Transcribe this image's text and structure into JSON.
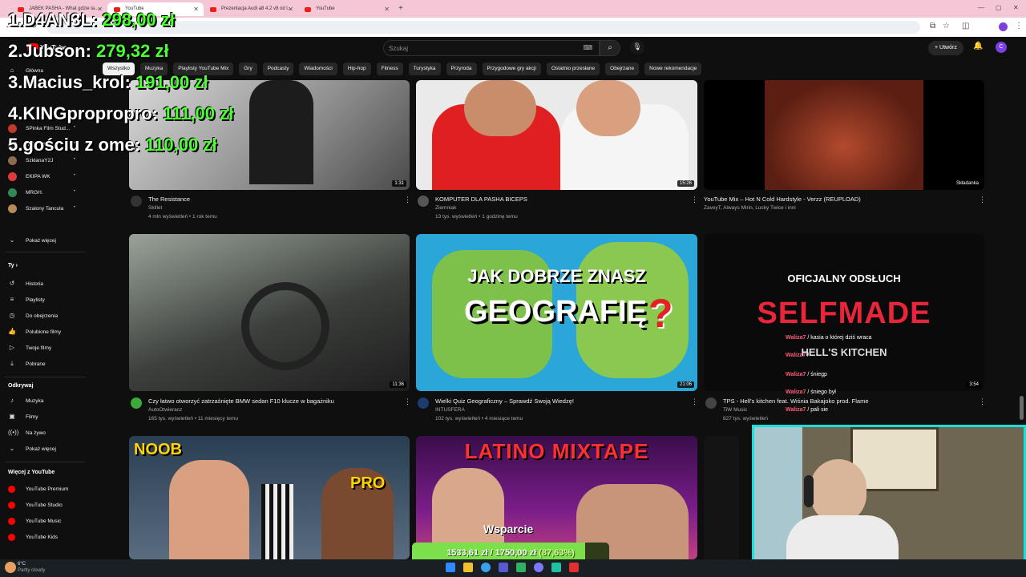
{
  "browser": {
    "tabs": [
      {
        "title": "JABEK PASHA - What gdzie ta..."
      },
      {
        "title": "YouTube"
      },
      {
        "title": "Prezentacja Audi a8 4.2 v8 od l..."
      },
      {
        "title": "YouTube"
      }
    ]
  },
  "header": {
    "logo": "YouTube",
    "search_placeholder": "Szukaj",
    "create_label": "Utwórz",
    "avatar_letter": "C"
  },
  "chips": [
    "Wszystko",
    "Muzyka",
    "Playlisty YouTube Mix",
    "Gry",
    "Podcasty",
    "Wiadomości",
    "Hip-hop",
    "Fitness",
    "Turystyka",
    "Przyroda",
    "Przygodowe gry akcji",
    "Ostatnio przesłane",
    "Obejrzane",
    "Nowe rekomendacje"
  ],
  "sidebar": {
    "main": [
      {
        "label": "Główna"
      }
    ],
    "subscriptions": [
      {
        "label": "SPinka Film Stud...",
        "color": "#c0392b"
      },
      {
        "label": "SENTINO",
        "color": "#555555"
      },
      {
        "label": "SzklanaY2J",
        "color": "#8e6b4f"
      },
      {
        "label": "EKIPA WK",
        "color": "#e03a3a"
      },
      {
        "label": "MRGH.",
        "color": "#2e8b57"
      },
      {
        "label": "Szalony Tancula",
        "color": "#b88a5a"
      }
    ],
    "show_more": "Pokaż więcej",
    "you_header": "Ty",
    "you": [
      {
        "label": "Historia",
        "icon": "history-icon"
      },
      {
        "label": "Playlisty",
        "icon": "playlist-icon"
      },
      {
        "label": "Do obejrzenia",
        "icon": "clock-icon"
      },
      {
        "label": "Polubione filmy",
        "icon": "like-icon"
      },
      {
        "label": "Twoje filmy",
        "icon": "play-icon"
      },
      {
        "label": "Pobrane",
        "icon": "download-icon"
      }
    ],
    "explore_header": "Odkrywaj",
    "explore": [
      {
        "label": "Muzyka",
        "icon": "music-icon"
      },
      {
        "label": "Filmy",
        "icon": "film-icon"
      },
      {
        "label": "Na żywo",
        "icon": "live-icon"
      }
    ],
    "show_more_2": "Pokaż więcej",
    "more_header": "Więcej z YouTube",
    "more": [
      {
        "label": "YouTube Premium"
      },
      {
        "label": "YouTube Studio"
      },
      {
        "label": "YouTube Music"
      },
      {
        "label": "YouTube Kids"
      }
    ]
  },
  "videos": [
    {
      "title": "The Resistance",
      "channel": "Skillet",
      "meta": "4 mln wyświetleń • 1 rok temu",
      "duration": "1:31"
    },
    {
      "title": "KOMPUTER DLA PASHA BICEPS",
      "channel": "Ziemniak",
      "meta": "13 tys. wyświetleń • 1 godzinę temu",
      "duration": "15:26"
    },
    {
      "title": "YouTube Mix – Hot N Cold Hardstyle - Verzz (REUPLOAD)",
      "channel": "ZaveyT, Always Mirin, Lucky Twice i inni",
      "meta": "",
      "duration": "Składanka"
    },
    {
      "title": "Czy łatwo otworzyć zatrzaśnięte BMW sedan F10 klucze w bagażniku",
      "channel": "AutoOtwieracz",
      "meta": "165 tys. wyświetleń • 11 miesięcy temu",
      "duration": "11:36"
    },
    {
      "title": "Wielki Quiz Geograficzny – Sprawdź Swoją Wiedzę!",
      "channel": "INTUSFERA",
      "meta": "102 tys. wyświetleń • 4 miesiące temu",
      "duration": "21:06"
    },
    {
      "title": "TPS - Hell's kitchen feat. Wiśnia Bakajoko prod. Flame",
      "channel": "TiW Music",
      "meta": "827 tys. wyświetleń",
      "duration": "3:54"
    }
  ],
  "thumb_text": {
    "geo_line1": "JAK DOBRZE ZNASZ",
    "geo_line2": "GEOGRAFIĘ",
    "geo_q": "?",
    "tps_line1": "OFICJALNY ODSŁUCH",
    "tps_line2": "SELFMADE",
    "tps_line3": "HELL'S KITCHEN",
    "noob": "NOOB",
    "pro": "PRO",
    "latino": "LATINO MIXTAPE",
    "wsparcie": "Wsparcie"
  },
  "leaderboard": [
    {
      "rank": "1.",
      "name": "D4AN3L:",
      "amount": "298,00 zł"
    },
    {
      "rank": "2.",
      "name": "Jubson:",
      "amount": "279,32 zł"
    },
    {
      "rank": "3.",
      "name": "Macius_krol:",
      "amount": "191,00 zł"
    },
    {
      "rank": "4.",
      "name": "KINGpropropro:",
      "amount": "111,00 zł"
    },
    {
      "rank": "5.",
      "name": "gościu z ome:",
      "amount": "110,00 zł"
    }
  ],
  "chat": [
    {
      "user": "Walizа7",
      "text": "kasia o której dziś wraca"
    },
    {
      "user": "Walizа7",
      "text": ""
    },
    {
      "user": "Walizа7",
      "text": "śniegp"
    },
    {
      "user": "Walizа7",
      "text": "śniego był"
    },
    {
      "user": "Walizа7",
      "text": "pali sie"
    }
  ],
  "goal": {
    "current": "1533,61 zł",
    "target": "1750,00 zł",
    "percent_label": "(87,63%)",
    "fraction": 0.8763
  },
  "weather": {
    "temp": "6°C",
    "desc": "Partly cloudy"
  },
  "colors": {
    "accent_green": "#4cff33",
    "youtube_red": "#ff0000",
    "webcam_border": "#16e0d8"
  }
}
